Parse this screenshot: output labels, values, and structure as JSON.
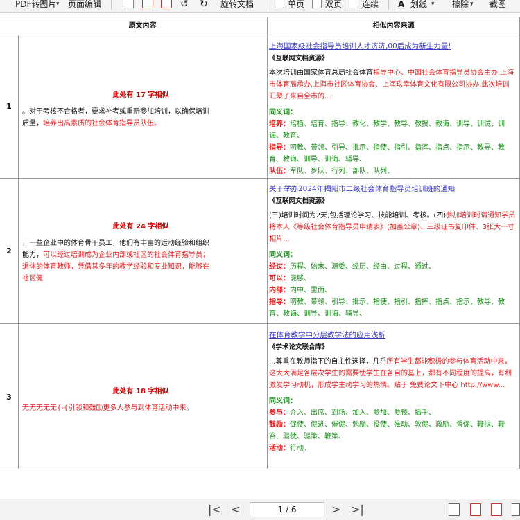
{
  "toolbar": {
    "pdf_to_image": "PDF转图片",
    "page_edit": "页面编辑",
    "rotate_doc": "旋转文档",
    "single_page": "单页",
    "double_page": "双页",
    "continuous": "连续",
    "highlight": "划线",
    "erase": "擦除",
    "screenshot": "截图"
  },
  "table": {
    "header_original": "原文内容",
    "header_source": "相似内容来源",
    "rows": [
      {
        "num": "1",
        "similar": "此处有 17 字相似",
        "text_plain": "。对于考核不合格者，要求补考或重新参加培训，以确保培训质量，",
        "text_red": "培养出高素质的社会体育指导员队伍。",
        "link": "上海国家级社会指导员培训人才济济,00后成为新生力量!",
        "source": "《互联网文档资源》",
        "excerpt_plain": "本次培训由国家体育总局社会体育",
        "excerpt_red": "指导中心、中国社会体育指导员协会主办,上海市体育局承办,上海市社区体育协会、上海玖幸体育文化有限公司协办,此次培训汇聚了来自全市的...",
        "syn_title": "同义词：",
        "synonyms": [
          {
            "k": "培养：",
            "v": "培植、培育、指导、教化、教学、教导、教授、教诲、训导、训诫、训诲、教育、"
          },
          {
            "k": "指导：",
            "v": "叨教、带领、引导、批示、指使、指引、指挥、指点、指示、教导、教育、教诲、训导、训诲、辅导、"
          },
          {
            "k": "队伍：",
            "v": "军队、步队、行列、部队、队列、"
          }
        ]
      },
      {
        "num": "2",
        "similar": "此处有 24 字相似",
        "text_plain": "，一些企业中的体育骨干员工，他们有丰富的运动经验和组织能力，",
        "text_red": "可以经过培训成为企业内部或社区的社会体育指导员；退休的体育教师，凭借其多年的教学经验和专业知识，能够在社区健",
        "link": "关于举办2024年揭阳市二级社会体育指导员培训班的通知",
        "source": "《互联网文档资源》",
        "excerpt_plain": "(三)培训时间为2天,包括理论学习、技能培训、考核。(四)",
        "excerpt_red": "参加培训时请通知学员将本人《等级社会体育指导员申请表》(加盖公章)、三级证书复印件、3张大一寸相片...",
        "syn_title": "同义词：",
        "synonyms": [
          {
            "k": "经过：",
            "v": "历程、始末、源委、经历、经由、过程、通过、"
          },
          {
            "k": "可以：",
            "v": "能够、"
          },
          {
            "k": "内部：",
            "v": "内中、里面、"
          },
          {
            "k": "指导：",
            "v": "叨教、带领、引导、批示、指使、指引、指挥、指点、指示、教导、教育、教诲、训导、训诲、辅导、"
          }
        ]
      },
      {
        "num": "3",
        "similar": "此处有 18 字相似",
        "text_plain": "",
        "text_red": "无无无无无{-{引领和鼓励更多人参与到体育活动中来。",
        "link": "在体育教学中分层教学法的应用浅析",
        "source": "《学术论文联合库》",
        "excerpt_plain": "...尊重在教师指下的自主性选择，几乎",
        "excerpt_red": "所有学生都能积极的参与体育活动中来，这大大满足各层次学生的需要使学生在各自的基上，都有不同程度的提高，有利激发学习动机，形成学主动学习的热情。贴于 免费论文下中心 http://www...",
        "syn_title": "同义词：",
        "synonyms": [
          {
            "k": "参与：",
            "v": "介入、出席、到场、加入、参加、参预、插手、"
          },
          {
            "k": "鼓励：",
            "v": "促使、促进、催促、勉励、役使、推动、敦促、激励、督促、鞭挞、鞭笞、驱使、驱策、鞭策、"
          },
          {
            "k": "活动：",
            "v": "行动、"
          }
        ]
      }
    ]
  },
  "pager": {
    "page_display": "1 / 6"
  }
}
